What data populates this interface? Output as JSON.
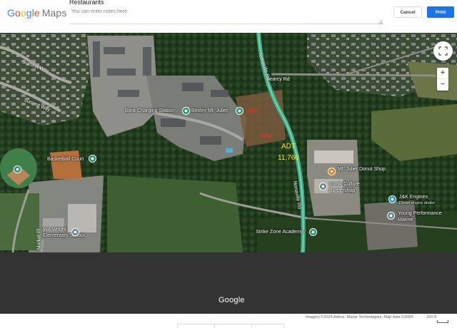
{
  "header": {
    "logo_google": "Google",
    "logo_maps": "Maps",
    "notes_title": "Restaurants",
    "notes_placeholder": "You can enter notes here.",
    "cancel_label": "Cancel",
    "print_label": "Print"
  },
  "map": {
    "roads": {
      "summit_way_1": "Summit Way",
      "summit_way_2": "Summit Way",
      "searcy_rd": "Searcy Rd",
      "nonaville_rd_1": "Nonaville Rd",
      "nonaville_rd_2": "Nonaville Rd",
      "market_pl": "Market Pl"
    },
    "places": {
      "blink": "Blink Charging Station",
      "bexley": "Bexley Mt. Juliet",
      "basketball": "Basketball Court",
      "wa_wright_1": "WA Wright",
      "wa_wright_2": "Elementary School",
      "donut": "Mt. Juliet Donut Shop",
      "iconic_1": "Iconic Culture",
      "iconic_2": "Barbershop",
      "jk": "J&K Engines",
      "jk_sub": "Diesel engine dealer",
      "young_1": "Young Performance",
      "young_2": "Marine",
      "strike": "Strike Zone Academy"
    },
    "annotations": {
      "site_1": "Site",
      "site_2": "Site",
      "adt_label": "ADT",
      "adt_value": "11,760"
    },
    "controls": {
      "zoom_in": "+",
      "zoom_out": "−"
    },
    "icons": {
      "fullscreen": "fullscreen-icon",
      "pin": "map-pin-icon"
    }
  },
  "footer": {
    "watermark": "Google",
    "credits": "Imagery ©2024 Airbus, Maxar Technologies, Map data ©2024",
    "scale": "200 ft"
  },
  "colors": {
    "print_button": "#1a73e8",
    "route": "#3fae8a",
    "site_annotation": "#ff2a2a",
    "adt_annotation": "#f6e51c"
  }
}
